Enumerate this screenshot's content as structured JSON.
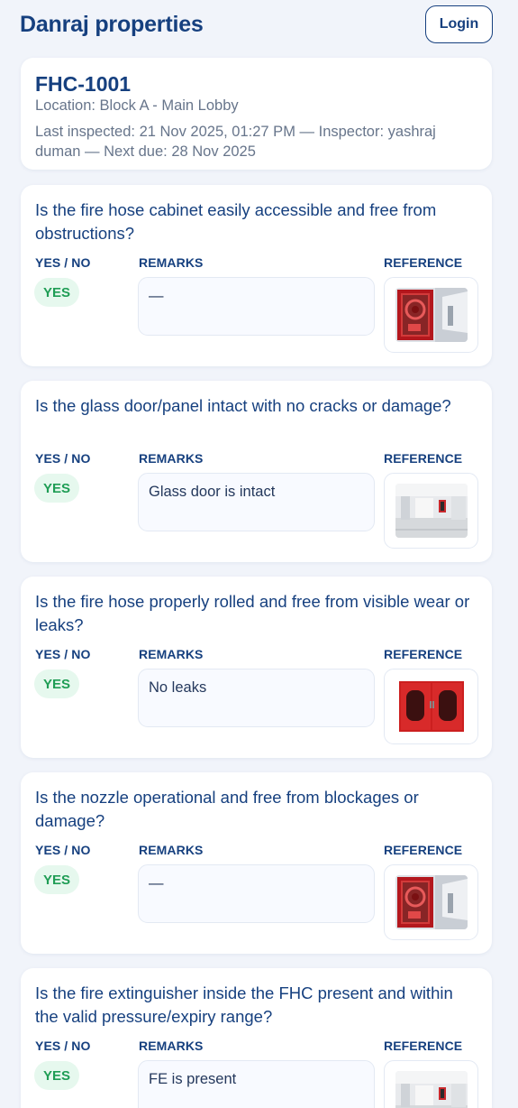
{
  "header": {
    "brand": "Danraj properties",
    "login_label": "Login"
  },
  "asset": {
    "id": "FHC-1001",
    "location": "Location: Block A - Main Lobby",
    "inspection_meta": "Last inspected: 21 Nov 2025, 01:27 PM — Inspector: yashraj duman — Next due: 28 Nov 2025"
  },
  "column_labels": {
    "yes_no": "YES / NO",
    "remarks": "REMARKS",
    "reference": "REFERENCE"
  },
  "checklist": [
    {
      "question": "Is the fire hose cabinet easily accessible and free from obstructions?",
      "answer": "YES",
      "remarks": "—",
      "reference_image": "cabinet-in-corridor"
    },
    {
      "question": "Is the glass door/panel intact with no cracks or damage?",
      "answer": "YES",
      "remarks": "Glass door is intact",
      "reference_image": "lobby-wall-cabinet"
    },
    {
      "question": "Is the fire hose properly rolled and free from visible wear or leaks?",
      "answer": "YES",
      "remarks": "No leaks",
      "reference_image": "red-double-door-cabinet"
    },
    {
      "question": "Is the nozzle operational and free from blockages or damage?",
      "answer": "YES",
      "remarks": "—",
      "reference_image": "cabinet-in-corridor"
    },
    {
      "question": "Is the fire extinguisher inside the FHC present and within the valid pressure/expiry range?",
      "answer": "YES",
      "remarks": "FE is present",
      "reference_image": "lobby-wall-cabinet"
    }
  ],
  "colors": {
    "primary": "#16407f",
    "background": "#f1f4fa",
    "yes_badge_bg": "#e6f8ee",
    "yes_badge_text": "#1f9d55"
  }
}
